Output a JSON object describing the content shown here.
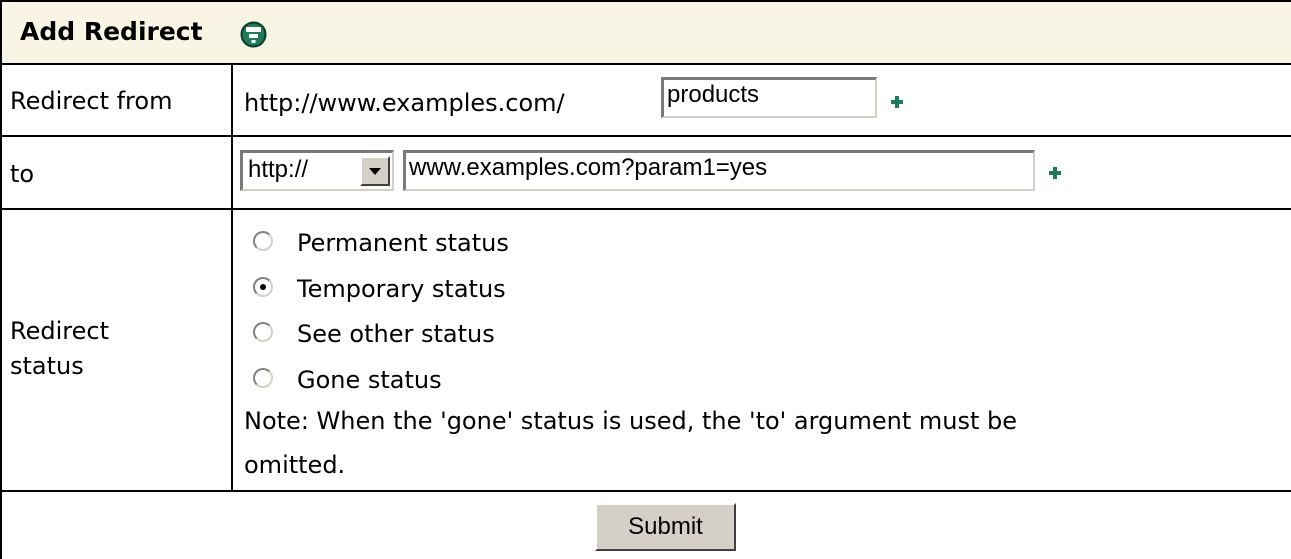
{
  "form": {
    "title": "Add Redirect",
    "help_icon": "help-question-icon",
    "accent_color": "#1f7a57",
    "header_bg": "#f9f5e4"
  },
  "redirect_from": {
    "label": "Redirect from",
    "prefix": "http://www.examples.com/",
    "value": "products",
    "add_icon": "plus-icon"
  },
  "redirect_to": {
    "label": "to",
    "protocol": "http://",
    "value": "www.examples.com?param1=yes",
    "add_icon": "plus-icon"
  },
  "status": {
    "label_line1": "Redirect",
    "label_line2": "status",
    "options": [
      {
        "label": "Permanent status",
        "checked": false
      },
      {
        "label": "Temporary status",
        "checked": true
      },
      {
        "label": "See other status",
        "checked": false
      },
      {
        "label": "Gone status",
        "checked": false
      }
    ],
    "note_line1": "Note: When the 'gone' status is used, the 'to' argument must be",
    "note_line2": "omitted."
  },
  "submit_label": "Submit"
}
